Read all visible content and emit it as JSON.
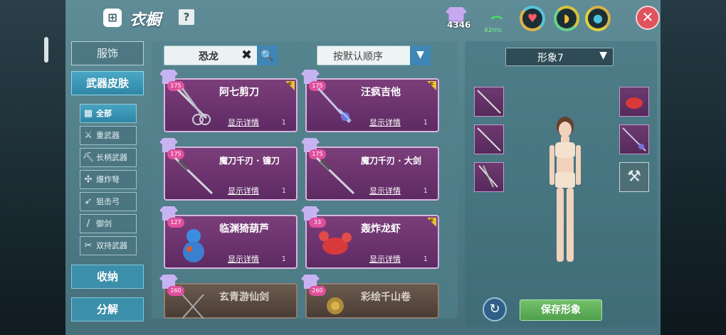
{
  "header": {
    "title": "衣橱",
    "wardrobe_glyph": "⊞",
    "help_label": "?"
  },
  "status": {
    "currency": "4346",
    "ping": "42ms"
  },
  "rings": [
    {
      "icon": "♥",
      "name": "heart"
    },
    {
      "icon": "◗",
      "name": "stamina"
    },
    {
      "icon": "●",
      "name": "water"
    }
  ],
  "close_label": "✕",
  "nav": {
    "fashion": "服饰",
    "weapon_skin": "武器皮肤",
    "storage": "收纳",
    "decompose": "分解"
  },
  "subnav": [
    {
      "icon": "▦",
      "label": "全部"
    },
    {
      "icon": "⚔",
      "label": "重武器"
    },
    {
      "icon": "⛏",
      "label": "长柄武器"
    },
    {
      "icon": "✣",
      "label": "爆炸弩"
    },
    {
      "icon": "➶",
      "label": "狙击弓"
    },
    {
      "icon": "/",
      "label": "御剑"
    },
    {
      "icon": "✂",
      "label": "双持武器"
    }
  ],
  "search": {
    "value": "恐龙",
    "clear": "✖",
    "go": "🔍"
  },
  "sort": {
    "value": "按默认顺序",
    "arrow": "▼"
  },
  "items": [
    {
      "name": "阿七剪刀",
      "level": "175",
      "flag": "F",
      "detail": "显示详情",
      "count": "1"
    },
    {
      "name": "汪疯吉他",
      "level": "175",
      "flag": "F",
      "detail": "显示详情",
      "count": "1"
    },
    {
      "name": "魔刀千刃 · 镰刀",
      "level": "175",
      "flag": "",
      "detail": "显示详情",
      "count": "1"
    },
    {
      "name": "魔刀千刃 · 大剑",
      "level": "175",
      "flag": "",
      "detail": "显示详情",
      "count": "1"
    },
    {
      "name": "临渊猗葫芦",
      "level": "127",
      "flag": "",
      "detail": "显示详情",
      "count": "1"
    },
    {
      "name": "轰炸龙虾",
      "level": "33",
      "flag": "F",
      "detail": "显示详情",
      "count": "1"
    },
    {
      "name": "玄青游仙剑",
      "level": "260",
      "flag": "",
      "detail": "",
      "count": ""
    },
    {
      "name": "彩绘千山卷",
      "level": "260",
      "flag": "",
      "detail": "",
      "count": ""
    }
  ],
  "preview": {
    "look": "形象7",
    "arrow": "▼",
    "save": "保存形象",
    "refresh": "↻",
    "cross_weapons": "⚒"
  }
}
